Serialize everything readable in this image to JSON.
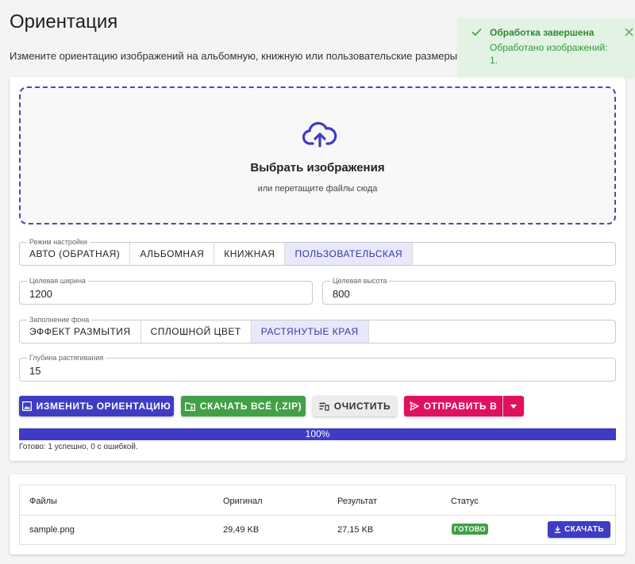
{
  "page": {
    "title": "Ориентация",
    "subtitle": "Измените ориентацию изображений на альбомную, книжную или пользовательские размеры с"
  },
  "dropzone": {
    "title": "Выбрать изображения",
    "hint": "или перетащите файлы сюда"
  },
  "mode": {
    "legend": "Режим настройки",
    "options": [
      "Авто (обратная)",
      "Альбомная",
      "Книжная",
      "Пользовательская"
    ],
    "selected": "Пользовательская"
  },
  "size": {
    "width_label": "Целевая ширина",
    "width_value": "1200",
    "height_label": "Целевая высота",
    "height_value": "800"
  },
  "fill": {
    "legend": "Заполнение фона",
    "options": [
      "Эффект размытия",
      "Сплошной цвет",
      "Растянутые края"
    ],
    "selected": "Растянутые края"
  },
  "stretch": {
    "label": "Глубина растягивания",
    "value": "15"
  },
  "actions": {
    "rotate": "Изменить ориентацию",
    "download_zip": "Скачать всё (.ZIP)",
    "clear": "Очистить",
    "send_to": "Отправить в"
  },
  "progress": {
    "percent": 100,
    "text": "100%",
    "status": "Готово: 1 успешно, 0 с ошибкой."
  },
  "table": {
    "headers": [
      "Файлы",
      "Оригинал",
      "Результат",
      "Статус"
    ],
    "rows": [
      {
        "file": "sample.png",
        "original": "29,49 KB",
        "result": "27,15 KB",
        "status": "Готово",
        "action": "Скачать"
      }
    ]
  },
  "toast": {
    "title": "Обработка завершена",
    "message": "Обработано изображений: 1."
  },
  "colors": {
    "primary": "#3f3cc4",
    "success": "#43a047",
    "danger": "#e0115f",
    "toast_bg": "#e3f3e3"
  }
}
